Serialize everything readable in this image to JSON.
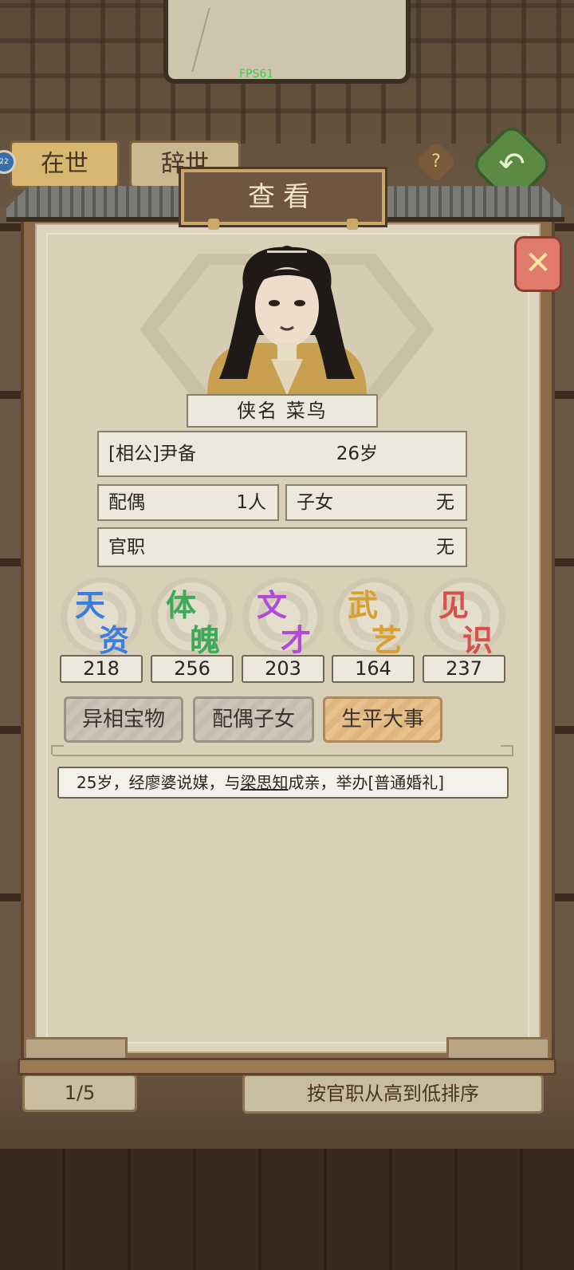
{
  "hud": {
    "fps": "FPS61"
  },
  "background": {
    "tabs": [
      "在世",
      "辞世"
    ],
    "help_label": "?",
    "badge": "22",
    "pager": "1/5",
    "sort_label": "按官职从高到低排序"
  },
  "dialog": {
    "title": "查看",
    "close_label": "✕",
    "name_title": "侠名 菜鸟",
    "identity": "[相公]尹备",
    "age": "26岁",
    "spouse_label": "配偶",
    "spouse_value": "1人",
    "children_label": "子女",
    "children_value": "无",
    "office_label": "官职",
    "office_value": "无",
    "stats": [
      {
        "c1": "天",
        "c2": "资",
        "value": "218",
        "color": "#3c7ee0"
      },
      {
        "c1": "体",
        "c2": "魄",
        "value": "256",
        "color": "#3daa5a"
      },
      {
        "c1": "文",
        "c2": "才",
        "value": "203",
        "color": "#b04ad8"
      },
      {
        "c1": "武",
        "c2": "艺",
        "value": "164",
        "color": "#d8a030"
      },
      {
        "c1": "见",
        "c2": "识",
        "value": "237",
        "color": "#d8504a"
      }
    ],
    "tabs": [
      "异相宝物",
      "配偶子女",
      "生平大事"
    ],
    "active_tab": "生平大事",
    "event": {
      "prefix": "25岁，经廖婆说媒，与",
      "partner": "梁思知",
      "suffix": "成亲，举办[普通婚礼]"
    }
  }
}
